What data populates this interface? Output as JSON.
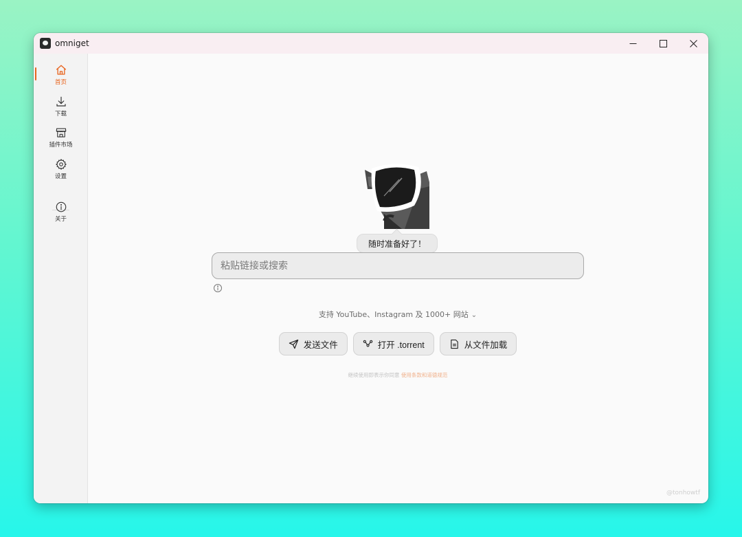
{
  "window": {
    "title": "omniget"
  },
  "controls": {
    "minimize": "—",
    "maximize": "☐",
    "close": "✕"
  },
  "sidebar": {
    "items": [
      {
        "id": "home",
        "label": "首页",
        "icon": "home-icon",
        "active": true
      },
      {
        "id": "downloads",
        "label": "下载",
        "icon": "download-icon",
        "active": false
      },
      {
        "id": "plugins",
        "label": "插件市场",
        "icon": "store-icon",
        "active": false
      },
      {
        "id": "settings",
        "label": "设置",
        "icon": "gear-icon",
        "active": false
      },
      {
        "id": "about",
        "label": "关于",
        "icon": "info-icon",
        "active": false
      }
    ]
  },
  "main": {
    "bubble": "随时准备好了！",
    "search_placeholder": "粘贴链接或搜索",
    "search_value": "",
    "support_text": "支持 YouTube、Instagram 及 1000+ 网站",
    "actions": [
      {
        "label": "发送文件",
        "icon": "send-icon"
      },
      {
        "label": "打开 .torrent",
        "icon": "torrent-icon"
      },
      {
        "label": "从文件加载",
        "icon": "file-icon"
      }
    ],
    "legal_text": "继续使用即表示你同意",
    "legal_link": "使用条款和道德规范",
    "watermark": "@tonhowtf"
  },
  "colors": {
    "accent": "#e8641e",
    "window_bg": "#fafafa",
    "sidebar_bg": "#f3f3f3"
  }
}
